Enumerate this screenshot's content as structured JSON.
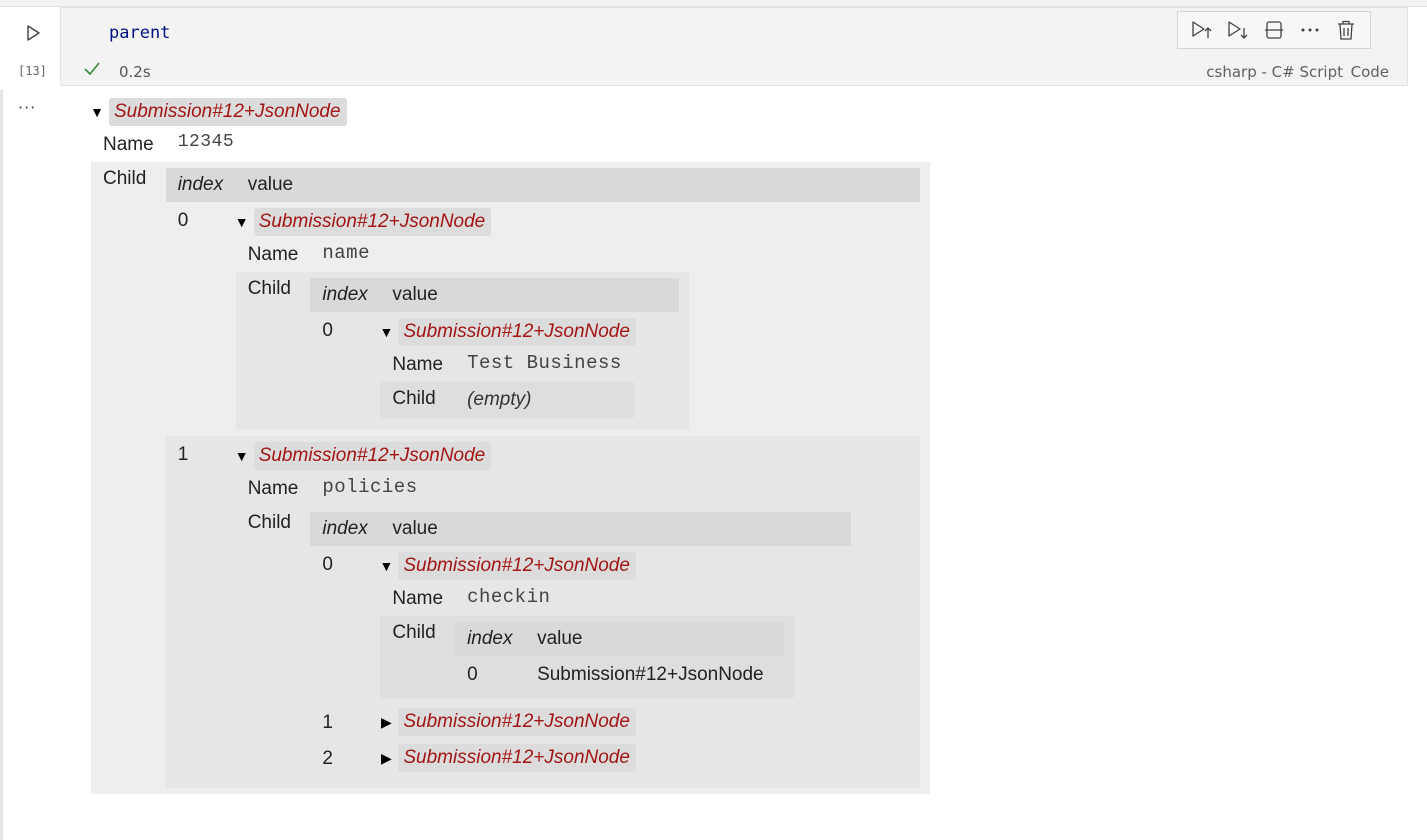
{
  "cell": {
    "code": "parent",
    "execution_count": "[13]",
    "status_time": "0.2s",
    "language": "csharp - C# Script",
    "kind": "Code"
  },
  "toolbar": {
    "icons": [
      "execute-above-icon",
      "execute-below-icon",
      "split-cell-icon",
      "more-icon",
      "delete-icon"
    ]
  },
  "output": {
    "more": "···",
    "root": {
      "title": "Submission#12+JsonNode",
      "name_label": "Name",
      "name_value": "12345",
      "child_label": "Child",
      "index_header": "index",
      "value_header": "value",
      "children": [
        {
          "index": "0",
          "title": "Submission#12+JsonNode",
          "name_label": "Name",
          "name_value": "name",
          "child_label": "Child",
          "index_header": "index",
          "value_header": "value",
          "children": [
            {
              "index": "0",
              "title": "Submission#12+JsonNode",
              "name_label": "Name",
              "name_value": "Test Business",
              "child_label": "Child",
              "child_value": "(empty)"
            }
          ]
        },
        {
          "index": "1",
          "title": "Submission#12+JsonNode",
          "name_label": "Name",
          "name_value": "policies",
          "child_label": "Child",
          "index_header": "index",
          "value_header": "value",
          "children": [
            {
              "index": "0",
              "title": "Submission#12+JsonNode",
              "name_label": "Name",
              "name_value": "checkin",
              "child_label": "Child",
              "index_header": "index",
              "value_header": "value",
              "children": [
                {
                  "index": "0",
                  "value": "Submission#12+JsonNode"
                }
              ]
            },
            {
              "index": "1",
              "title": "Submission#12+JsonNode",
              "collapsed": true
            },
            {
              "index": "2",
              "title": "Submission#12+JsonNode",
              "collapsed": true
            }
          ]
        }
      ]
    }
  }
}
